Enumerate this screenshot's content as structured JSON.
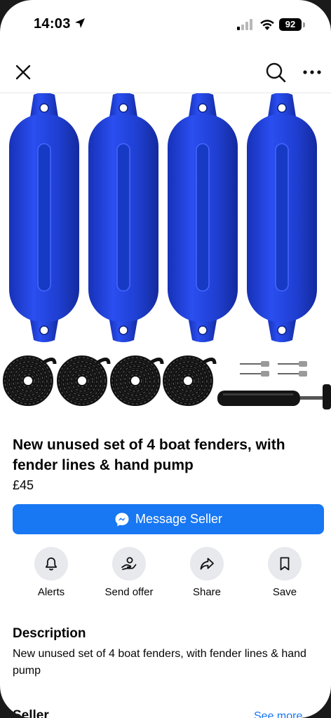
{
  "status_bar": {
    "time": "14:03",
    "battery": "92"
  },
  "nav": {
    "close_icon": "close-icon",
    "search_icon": "search-icon",
    "more_icon": "more-icon"
  },
  "listing": {
    "title": "New unused set of 4 boat fenders, with fender lines & hand pump",
    "price": "£45",
    "photo_colors": {
      "fender": "#1f3fd1",
      "rope": "#111111",
      "pump": "#141414"
    }
  },
  "message_button": {
    "label": "Message Seller",
    "icon": "messenger-icon",
    "color": "#1877f2"
  },
  "actions": [
    {
      "label": "Alerts",
      "icon": "bell-icon"
    },
    {
      "label": "Send offer",
      "icon": "offer-icon"
    },
    {
      "label": "Share",
      "icon": "share-icon"
    },
    {
      "label": "Save",
      "icon": "bookmark-icon"
    }
  ],
  "description": {
    "heading": "Description",
    "text": "New unused set of 4 boat fenders, with fender lines & hand pump"
  },
  "seller_section": {
    "heading": "Seller",
    "link": "See more"
  }
}
